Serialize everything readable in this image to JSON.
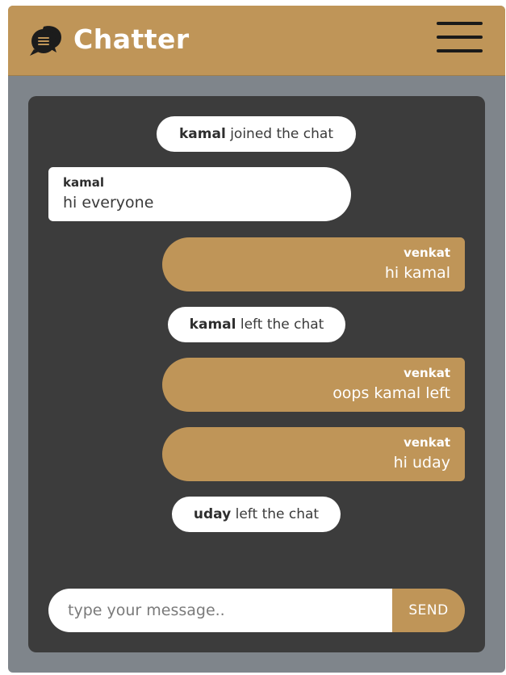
{
  "app": {
    "title": "Chatter",
    "logo_icon": "chat-bubbles-icon",
    "menu_icon": "hamburger-menu-icon"
  },
  "colors": {
    "accent": "#bf9558",
    "background": "#7f858b",
    "panel": "#3c3c3c",
    "bubble_light": "#ffffff"
  },
  "messages": [
    {
      "type": "event",
      "user": "kamal",
      "text": "joined the chat"
    },
    {
      "type": "incoming",
      "user": "kamal",
      "text": "hi everyone"
    },
    {
      "type": "outgoing",
      "user": "venkat",
      "text": "hi kamal"
    },
    {
      "type": "event",
      "user": "kamal",
      "text": "left the chat"
    },
    {
      "type": "outgoing",
      "user": "venkat",
      "text": "oops kamal left"
    },
    {
      "type": "outgoing",
      "user": "venkat",
      "text": "hi uday"
    },
    {
      "type": "event",
      "user": "uday",
      "text": "left the chat"
    }
  ],
  "composer": {
    "placeholder": "type your message..",
    "value": "",
    "send_label": "SEND"
  }
}
